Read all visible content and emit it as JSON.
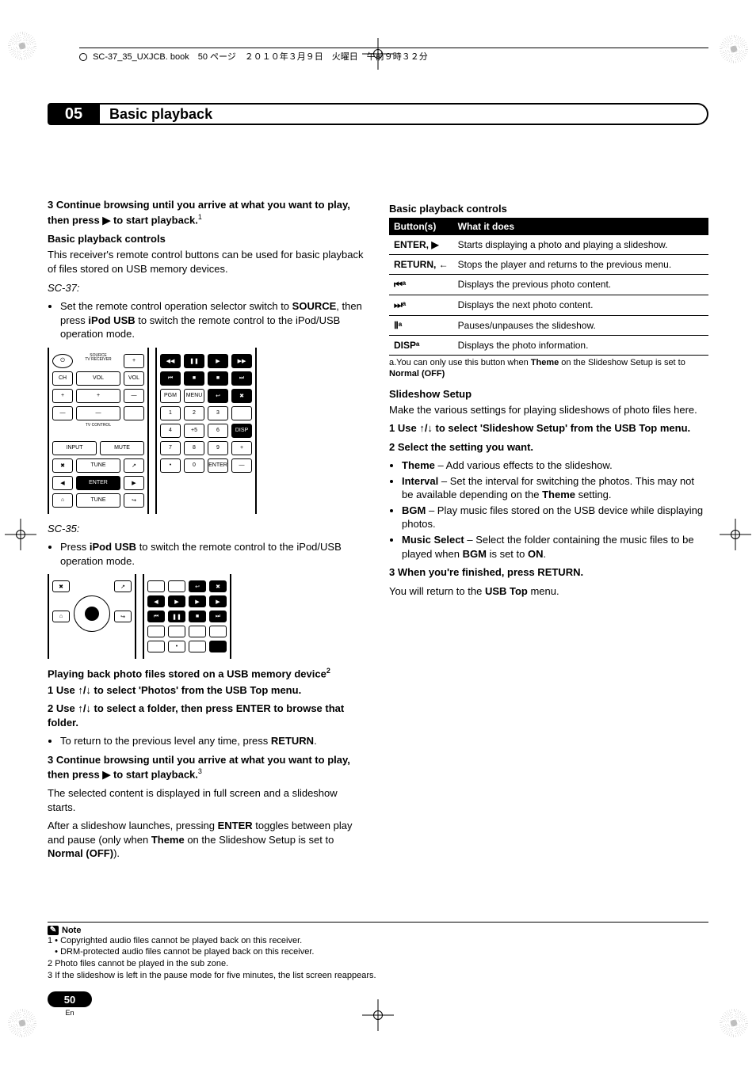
{
  "bookline": "SC-37_35_UXJCB. book　50 ページ　２０１０年３月９日　火曜日　午前９時３２分",
  "chapter": {
    "num": "05",
    "title": "Basic playback"
  },
  "left": {
    "step3a": "3   Continue browsing until you arrive at what you want to play, then press ",
    "step3b": " to start playback.",
    "sup1": "1",
    "h_controls": "Basic playback controls",
    "p_controls": "This receiver's remote control buttons can be used for basic playback of files stored on USB memory devices.",
    "sc37": "SC-37:",
    "li37a": "Set the remote control operation selector switch to ",
    "li37b": ", then press ",
    "li37c": " to switch the remote control to the iPod/USB operation mode.",
    "source": "SOURCE",
    "ipodusb": "iPod USB",
    "sc35": "SC-35:",
    "li35a": "Press ",
    "li35b": " to switch the remote control to the iPod/USB operation mode.",
    "h_photo": "Playing back photo files stored on a USB memory device",
    "sup2": "2",
    "p1": "1   Use ",
    "p1b": " to select 'Photos' from the USB Top menu.",
    "p2": "2   Use ",
    "p2b": " to select a folder, then press ENTER to browse that folder.",
    "li_ret": "To return to the previous level any time, press ",
    "return": "RETURN",
    "p3a": "3   Continue browsing until you arrive at what you want to play, then press ",
    "p3b": " to start playback.",
    "sup3": "3",
    "p_full": "The selected content is displayed in full screen and a slideshow starts.",
    "p_enter_a": "After a slideshow launches, pressing ",
    "p_enter_b": " toggles between play and pause (only when ",
    "p_enter_c": " on the Slideshow Setup is set to ",
    "p_enter_d": ").",
    "enter": "ENTER",
    "theme": "Theme",
    "normaloff": "Normal (OFF)",
    "updown": "↑/↓",
    "play": "▶"
  },
  "right": {
    "h_controls": "Basic playback controls",
    "th_btn": "Button(s)",
    "th_what": "What it does",
    "rows": [
      {
        "b": "ENTER, ▶",
        "d": "Starts displaying a photo and playing a slideshow."
      },
      {
        "b": "RETURN, ←",
        "d": "Stops the player and returns to the previous menu."
      },
      {
        "b": "⏮ᵃ",
        "d": "Displays the previous photo content."
      },
      {
        "b": "⏭ᵃ",
        "d": "Displays the next photo content."
      },
      {
        "b": "Ⅱᵃ",
        "d": "Pauses/unpauses the slideshow."
      },
      {
        "b": "DISPᵃ",
        "d": "Displays the photo information."
      }
    ],
    "tnote_a": "a.You can only use this button when ",
    "tnote_b": " on the Slideshow Setup is set to ",
    "theme": "Theme",
    "normaloff": "Normal (OFF)",
    "h_ss": "Slideshow Setup",
    "p_ss": "Make the various settings for playing slideshows of photo files here.",
    "s1a": "1   Use ",
    "s1b": " to select 'Slideshow Setup' from the USB Top menu.",
    "s2": "2   Select the setting you want.",
    "li_theme": " – Add various effects to the slideshow.",
    "li_int_a": " – Set the interval for switching the photos. This may not be available depending on the ",
    "li_int_b": " setting.",
    "interval": "Interval",
    "li_bgm": " – Play music files stored on the USB device while displaying photos.",
    "bgm": "BGM",
    "li_ms_a": " – Select the folder containing the music files to be played when ",
    "li_ms_b": " is set to ",
    "li_ms_c": ".",
    "ms": "Music Select",
    "on": "ON",
    "s3": "3   When you're finished, press RETURN.",
    "p_back_a": "You will return to the ",
    "p_back_b": " menu.",
    "usbtop": "USB Top",
    "updown": "↑/↓"
  },
  "notes": {
    "hdr": "Note",
    "n1a": "Copyrighted audio files cannot be played back on this receiver.",
    "n1b": "DRM-protected audio files cannot be played back on this receiver.",
    "n2": "Photo files cannot be played in the sub zone.",
    "n3": "If the slideshow is left in the pause mode for five minutes, the list screen reappears."
  },
  "foot": {
    "page": "50",
    "lang": "En"
  }
}
